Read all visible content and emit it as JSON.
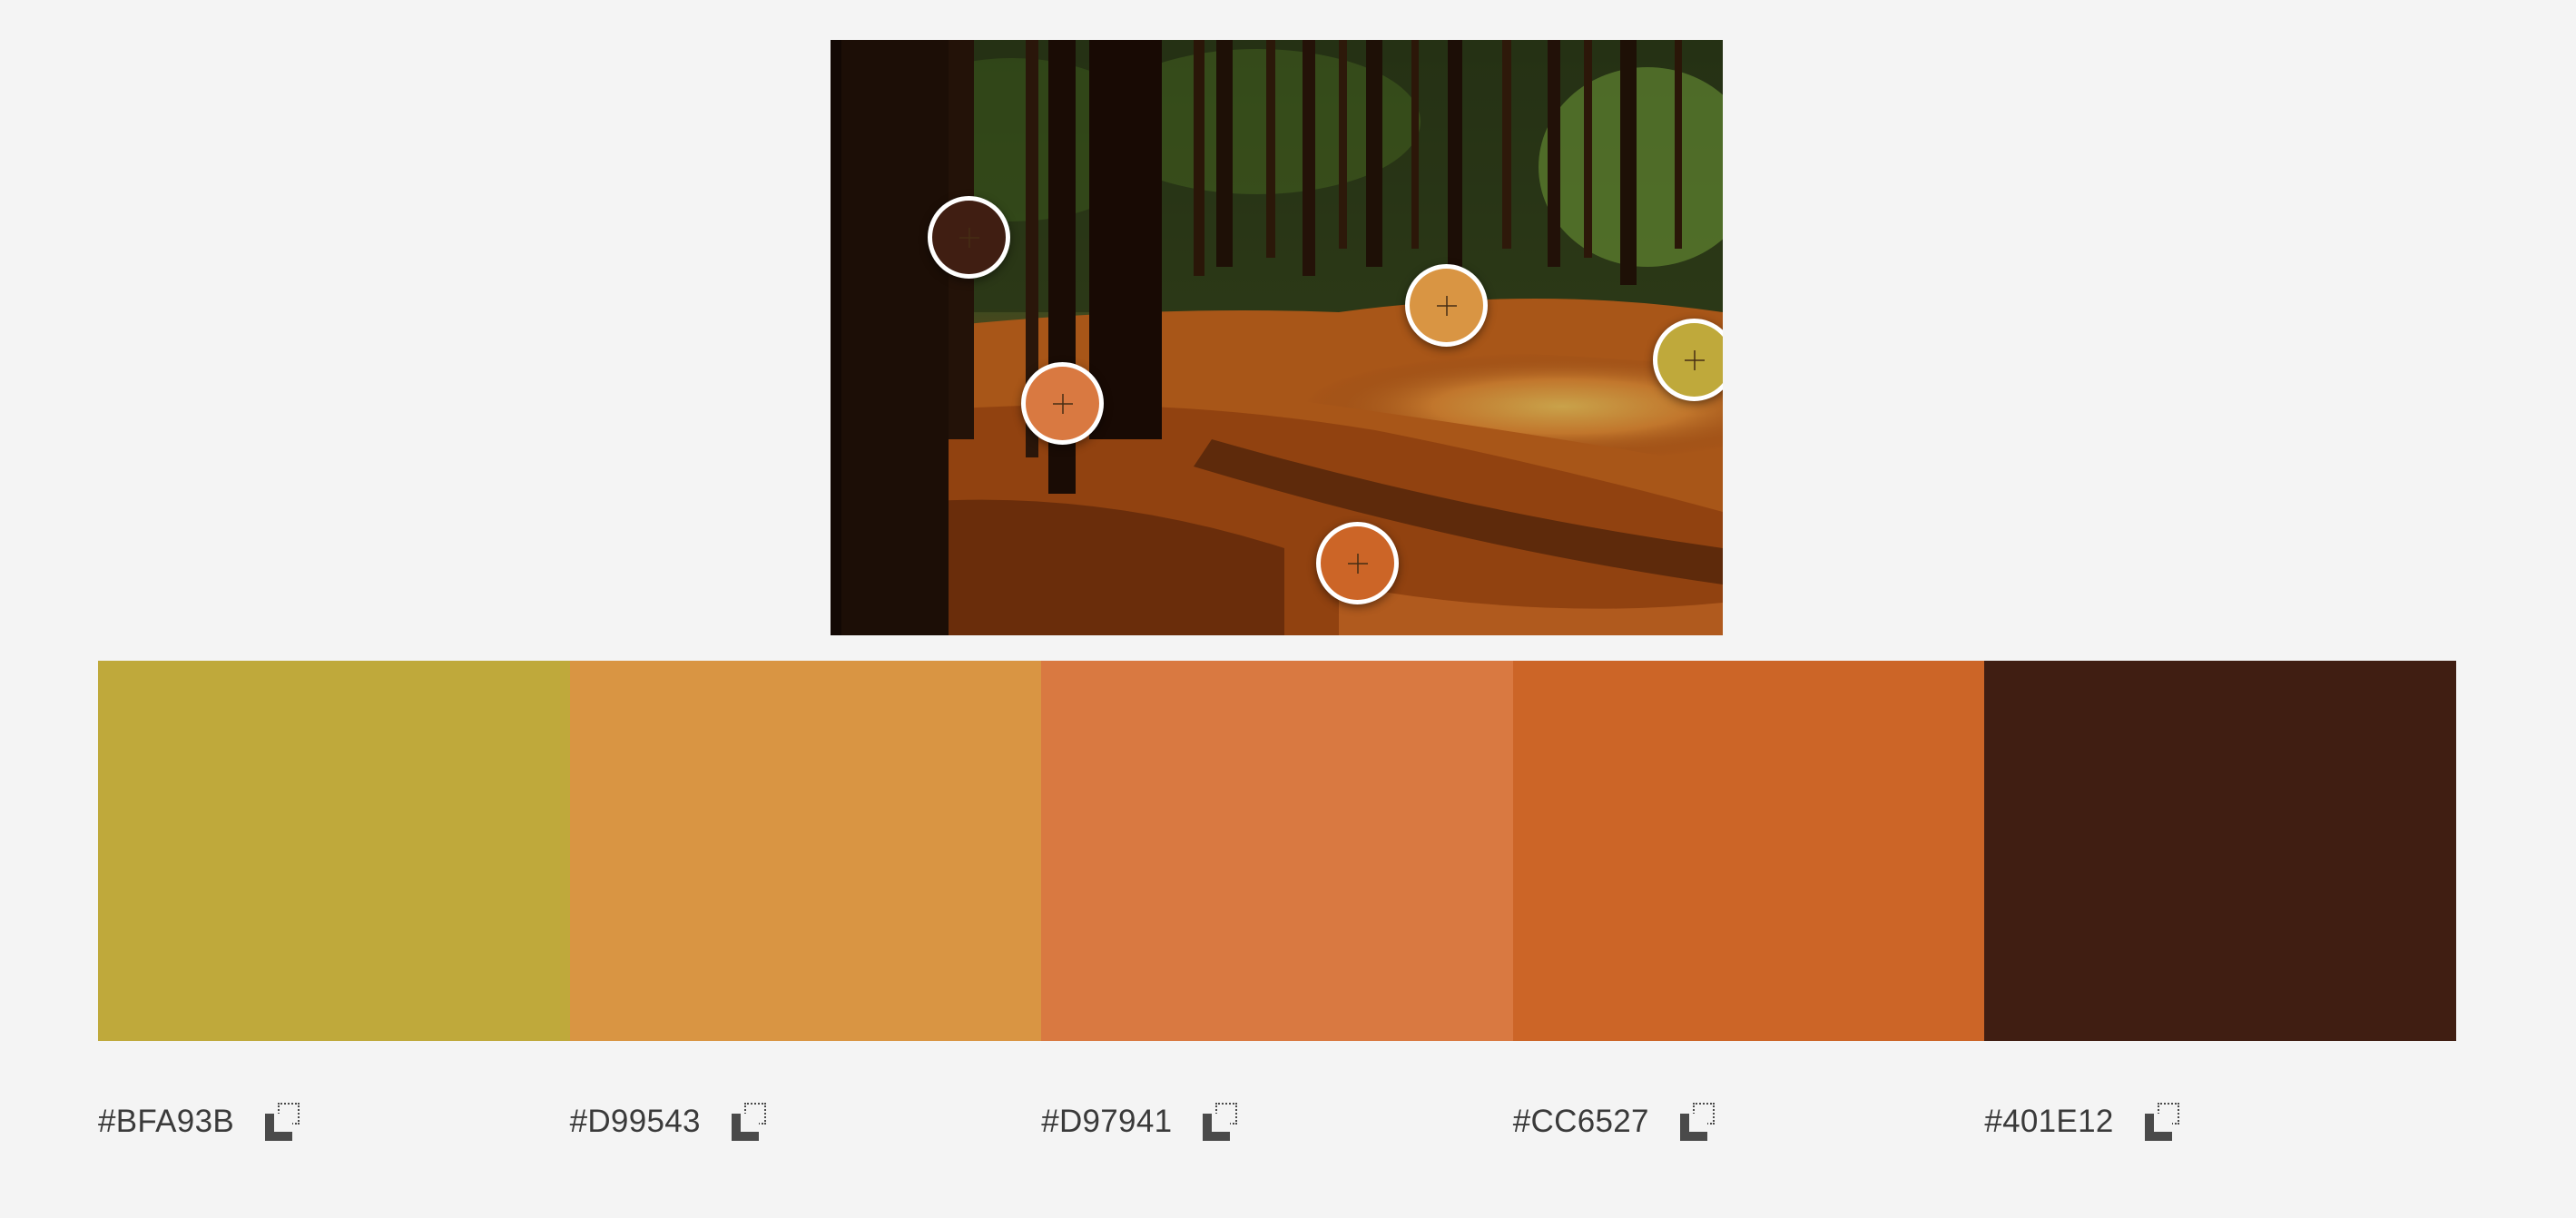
{
  "photo": {
    "pickers": [
      {
        "name": "picker-dark-brown",
        "color": "#401E12"
      },
      {
        "name": "picker-light-orange",
        "color": "#D99543"
      },
      {
        "name": "picker-olive",
        "color": "#BFA93B"
      },
      {
        "name": "picker-terracotta",
        "color": "#D97941"
      },
      {
        "name": "picker-burnt-orange",
        "color": "#CC6527"
      }
    ]
  },
  "palette": {
    "swatches": [
      {
        "hex": "#BFA93B",
        "color": "#BFA93B",
        "copy_icon": "copy-icon"
      },
      {
        "hex": "#D99543",
        "color": "#D99543",
        "copy_icon": "copy-icon"
      },
      {
        "hex": "#D97941",
        "color": "#D97941",
        "copy_icon": "copy-icon"
      },
      {
        "hex": "#CC6527",
        "color": "#CC6527",
        "copy_icon": "copy-icon"
      },
      {
        "hex": "#401E12",
        "color": "#401E12",
        "copy_icon": "copy-icon"
      }
    ]
  }
}
